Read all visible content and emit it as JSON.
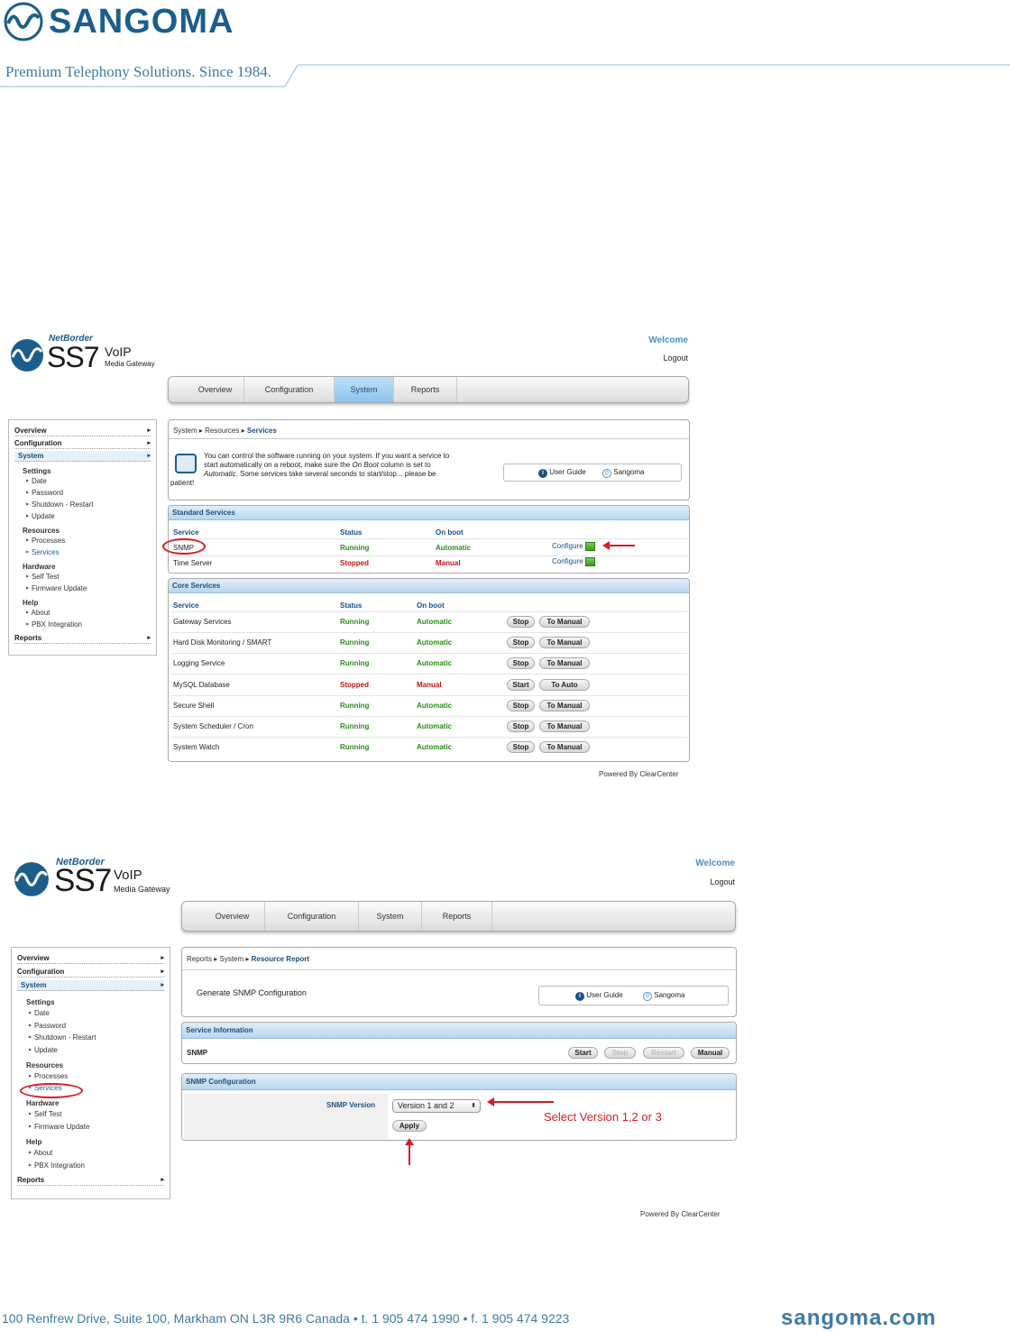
{
  "brand": {
    "name": "SANGOMA",
    "tagline": "Premium Telephony Solutions. Since 1984.",
    "address": "100 Renfrew Drive, Suite 100, Markham ON L3R 9R6 Canada  •  t. 1 905 474 1990  •  f. 1 905 474 9223",
    "website": "sangoma.com"
  },
  "product": {
    "netborder": "NetBorder",
    "ss7": "SS7",
    "voip": "VoIP",
    "gateway": "Media Gateway"
  },
  "header": {
    "welcome": "Welcome",
    "logout": "Logout"
  },
  "nav": {
    "overview": "Overview",
    "configuration": "Configuration",
    "system": "System",
    "reports": "Reports"
  },
  "sidebar": {
    "overview": "Overview",
    "configuration": "Configuration",
    "system": "System",
    "settings": "Settings",
    "date": "Date",
    "password": "Password",
    "shutdown": "Shutdown - Restart",
    "update": "Update",
    "resources": "Resources",
    "processes": "Processes",
    "services": "Services",
    "hardware": "Hardware",
    "self_test": "Self Test",
    "firmware": "Firmware Update",
    "help": "Help",
    "about": "About",
    "pbx": "PBX Integration",
    "reports": "Reports"
  },
  "guide": {
    "user_guide": "User Guide",
    "sangoma": "Sangoma"
  },
  "screen1": {
    "crumb": {
      "a": "System",
      "b": "Resources",
      "c": "Services"
    },
    "intro_1": "You can control the software running on your system.  If you want a service to",
    "intro_2a": "start automatically on a reboot, make sure the ",
    "intro_2b": "On Boot",
    "intro_2c": " column is set to",
    "intro_3a": "Automatic",
    "intro_3b": ".  Some services take several seconds to start/stop... please be",
    "intro_4": "patient!",
    "standard": {
      "title": "Standard Services",
      "cols": {
        "service": "Service",
        "status": "Status",
        "onboot": "On boot"
      },
      "rows": [
        {
          "service": "SNMP",
          "status": "Running",
          "onboot": "Automatic",
          "action": "Configure"
        },
        {
          "service": "Time Server",
          "status": "Stopped",
          "onboot": "Manual",
          "action": "Configure"
        }
      ]
    },
    "core": {
      "title": "Core Services",
      "cols": {
        "service": "Service",
        "status": "Status",
        "onboot": "On boot"
      },
      "rows": [
        {
          "service": "Gateway Services",
          "status": "Running",
          "onboot": "Automatic",
          "b1": "Stop",
          "b2": "To Manual"
        },
        {
          "service": "Hard Disk Monitoring / SMART",
          "status": "Running",
          "onboot": "Automatic",
          "b1": "Stop",
          "b2": "To Manual"
        },
        {
          "service": "Logging Service",
          "status": "Running",
          "onboot": "Automatic",
          "b1": "Stop",
          "b2": "To Manual"
        },
        {
          "service": "MySQL Database",
          "status": "Stopped",
          "onboot": "Manual",
          "b1": "Start",
          "b2": "To Auto"
        },
        {
          "service": "Secure Shell",
          "status": "Running",
          "onboot": "Automatic",
          "b1": "Stop",
          "b2": "To Manual"
        },
        {
          "service": "System Scheduler / Cron",
          "status": "Running",
          "onboot": "Automatic",
          "b1": "Stop",
          "b2": "To Manual"
        },
        {
          "service": "System Watch",
          "status": "Running",
          "onboot": "Automatic",
          "b1": "Stop",
          "b2": "To Manual"
        }
      ]
    },
    "powered": "Powered By ClearCenter"
  },
  "screen2": {
    "crumb": {
      "a": "Reports",
      "b": "System",
      "c": "Resource Report"
    },
    "intro": "Generate SNMP Configuration",
    "service_info": {
      "title": "Service Information",
      "name": "SNMP",
      "start": "Start",
      "stop": "Stop",
      "restart": "Restart",
      "manual": "Manual"
    },
    "snmp_config": {
      "title": "SNMP Configuration",
      "label": "SNMP Version",
      "value": "Version 1 and 2",
      "apply": "Apply"
    },
    "annotation": "Select Version 1,2 or 3",
    "powered": "Powered By ClearCenter"
  },
  "colors": {
    "accent": "#1b5e8c",
    "running": "#2a8c1a",
    "stopped": "#c0141a",
    "annotation": "#d61c24"
  }
}
